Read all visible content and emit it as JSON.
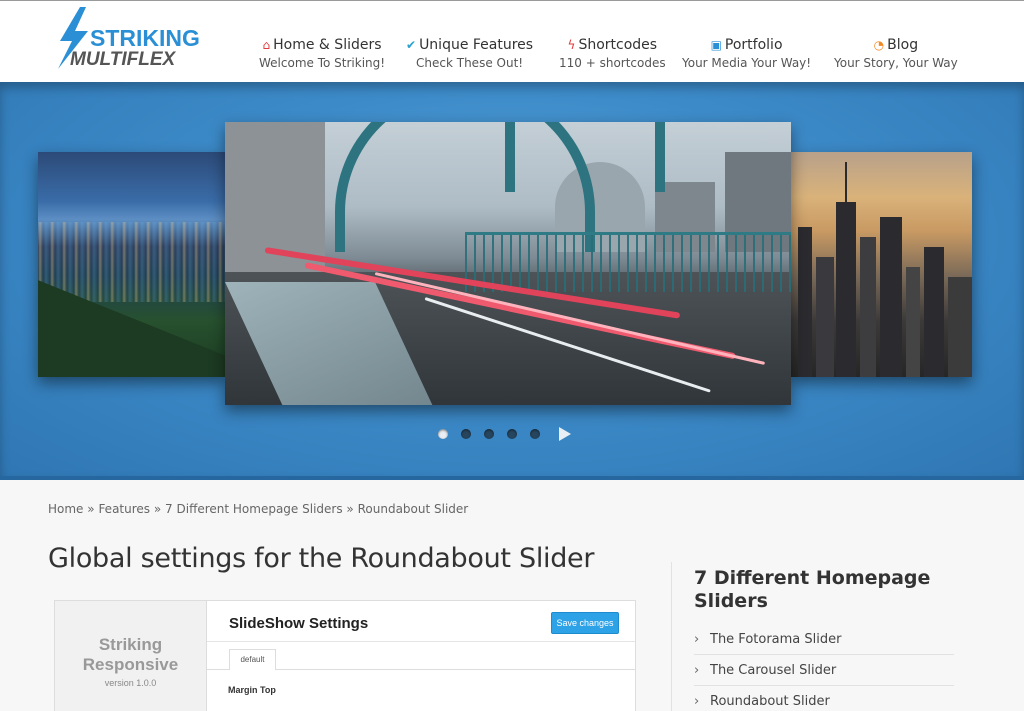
{
  "logo": {
    "line1": "STRIKING",
    "line2": "MULTIFLEX"
  },
  "nav": [
    {
      "icon": "home-icon",
      "glyph": "⌂",
      "label": "Home & Sliders",
      "sub": "Welcome To Striking!"
    },
    {
      "icon": "check-icon",
      "glyph": "✔",
      "label": "Unique Features",
      "sub": "Check These Out!"
    },
    {
      "icon": "bolt-icon",
      "glyph": "ϟ",
      "label": "Shortcodes",
      "sub": "110 + shortcodes"
    },
    {
      "icon": "image-icon",
      "glyph": "▣",
      "label": "Portfolio",
      "sub": "Your Media Your Way!"
    },
    {
      "icon": "rss-icon",
      "glyph": "◔",
      "label": "Blog",
      "sub": "Your Story, Your Way"
    }
  ],
  "slider": {
    "slide_count": 5,
    "active_index": 0
  },
  "breadcrumb": {
    "items": [
      "Home",
      "Features",
      "7 Different Homepage Sliders",
      "Roundabout Slider"
    ],
    "separator": "»"
  },
  "page_title": "Global settings for the Roundabout Slider",
  "settings_screenshot": {
    "brand_line1": "Striking",
    "brand_line2": "Responsive",
    "version": "version 1.0.0",
    "title": "SlideShow Settings",
    "save_label": "Save changes",
    "tab_label": "default",
    "field_label": "Margin Top"
  },
  "sidebar": {
    "title": "7 Different Homepage Sliders",
    "items": [
      "The Fotorama Slider",
      "The Carousel Slider",
      "Roundabout Slider"
    ]
  },
  "colors": {
    "accent": "#2a8fd4",
    "band": "#3d8bc9",
    "save_button": "#2ea2e6"
  }
}
